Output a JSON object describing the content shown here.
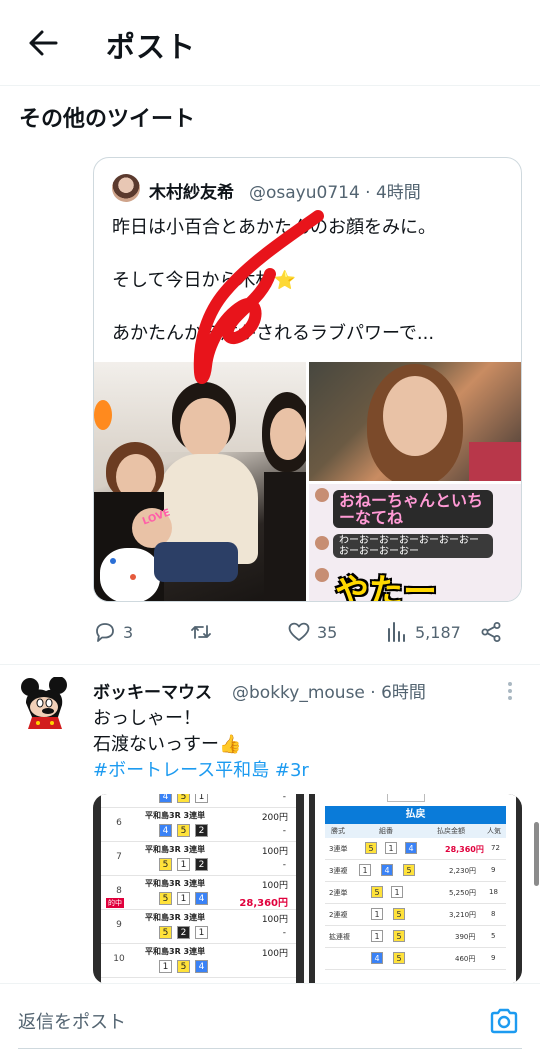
{
  "header": {
    "title": "ポスト"
  },
  "section": {
    "title": "その他のツイート"
  },
  "quoted_tweet": {
    "author_name": "木村紗友希",
    "handle_time": "@osayu0714 · 4時間",
    "lines": [
      "昨日は小百合とあかたんのお顔をみに。",
      "そして今日から木村⭐",
      "あかたんから注がされるラブパワーで..."
    ],
    "image_texts": {
      "bubble1": "おねーちゃんといちーなてね",
      "bubble2": "わーおーおーおーおーおーおーおーおーおーおー",
      "yata": "やたー",
      "love": "LOVE"
    }
  },
  "actions": {
    "replies": "3",
    "likes": "35",
    "views": "5,187"
  },
  "tweet": {
    "author_name": "ボッキーマウス",
    "handle_time": "@bokky_mouse · 6時間",
    "line1": "おっしゃー！",
    "line2": "石渡ないっすー👍",
    "hashtags": "#ボートレース平和島 #3r",
    "results": {
      "rows": [
        {
          "no": "6",
          "name": "平和島3R 3連単",
          "amount": "200円",
          "chips": [
            "4",
            "5",
            "2"
          ]
        },
        {
          "no": "7",
          "name": "平和島3R 3連単",
          "amount": "100円",
          "chips": [
            "5",
            "1",
            "2"
          ]
        },
        {
          "no": "8",
          "name": "平和島3R 3連単",
          "amount": "100円",
          "chips": [
            "5",
            "1",
            "4"
          ],
          "payout": "28,360円",
          "hit": "的中"
        },
        {
          "no": "9",
          "name": "平和島3R 3連単",
          "amount": "100円",
          "chips": [
            "5",
            "2",
            "1"
          ]
        },
        {
          "no": "10",
          "name": "平和島3R 3連単",
          "amount": "100円",
          "chips": [
            "1",
            "5",
            "4"
          ]
        }
      ],
      "top_chips": [
        "4",
        "5",
        "1"
      ]
    },
    "payout_table": {
      "header": "払戻",
      "cols": [
        "勝式",
        "組番",
        "払戻金額",
        "人気"
      ],
      "rows": [
        {
          "type": "3連単",
          "combo": [
            "5",
            "1",
            "4"
          ],
          "amount": "28,360円",
          "pop": "72",
          "red": true
        },
        {
          "type": "3連複",
          "combo": [
            "1",
            "4",
            "5"
          ],
          "amount": "2,230円",
          "pop": "9"
        },
        {
          "type": "2連単",
          "combo": [
            "5",
            "1"
          ],
          "amount": "5,250円",
          "pop": "18"
        },
        {
          "type": "2連複",
          "combo": [
            "1",
            "5"
          ],
          "amount": "3,210円",
          "pop": "8"
        },
        {
          "type": "拡連複",
          "combo": [
            "1",
            "5"
          ],
          "amount": "390円",
          "pop": "5"
        },
        {
          "type": "",
          "combo": [
            "4",
            "5"
          ],
          "amount": "460円",
          "pop": "9"
        }
      ]
    }
  },
  "reply": {
    "placeholder": "返信をポスト"
  },
  "colors": {
    "accent": "#1d9bf0",
    "text": "#0f1419",
    "muted": "#536471",
    "red_stroke": "#e8141b"
  }
}
